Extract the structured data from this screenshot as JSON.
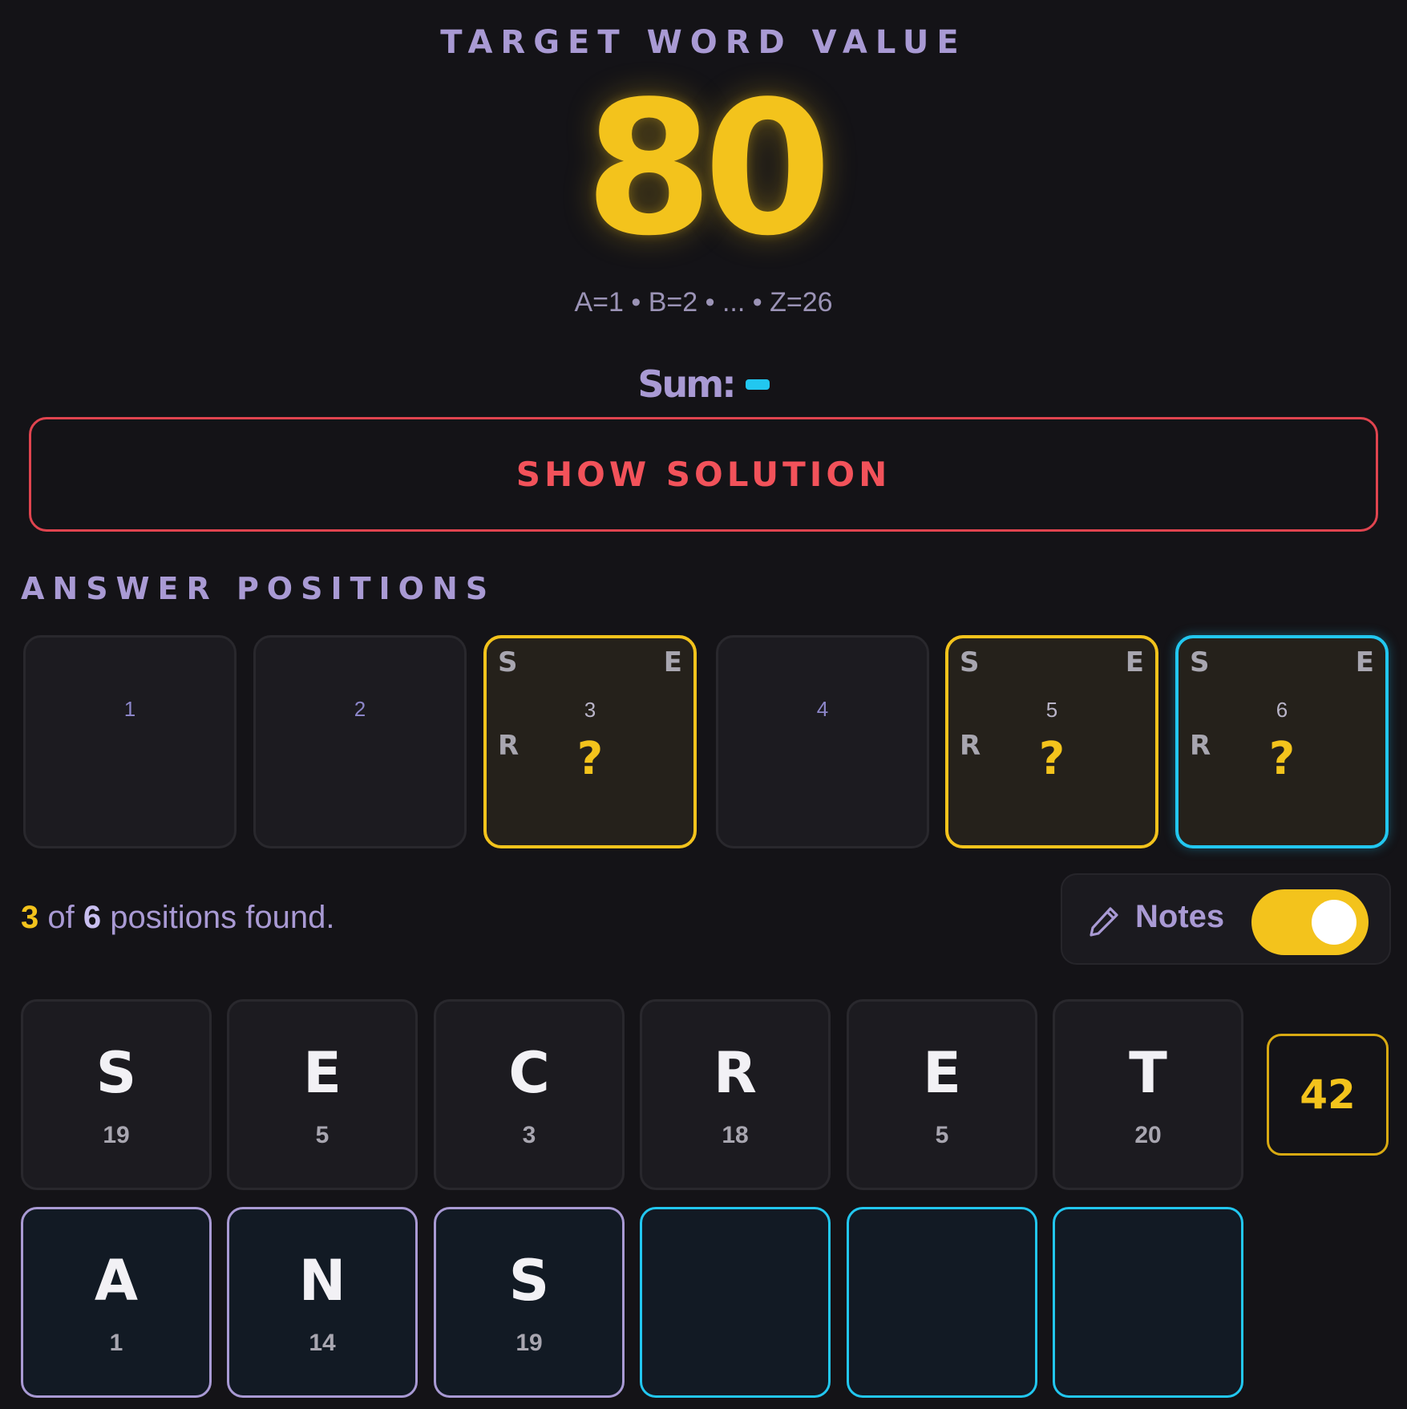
{
  "header": {
    "label": "TARGET WORD VALUE",
    "target": "80",
    "legend": "A=1 • B=2 • ... • Z=26",
    "sum_label": "Sum:"
  },
  "show_solution_label": "SHOW SOLUTION",
  "answer_positions": {
    "title": "ANSWER POSITIONS",
    "slots": [
      {
        "number": "1"
      },
      {
        "number": "2"
      },
      {
        "number": "3",
        "s": "S",
        "e": "E",
        "r": "R",
        "mark": "?"
      },
      {
        "number": "4"
      },
      {
        "number": "5",
        "s": "S",
        "e": "E",
        "r": "R",
        "mark": "?"
      },
      {
        "number": "6",
        "s": "S",
        "e": "E",
        "r": "R",
        "mark": "?"
      }
    ]
  },
  "status": {
    "found": "3",
    "of_word": "of",
    "total": "6",
    "suffix": "positions found."
  },
  "notes": {
    "label": "Notes",
    "icon": "pencil-icon",
    "enabled": true
  },
  "word_row": {
    "tiles": [
      {
        "letter": "S",
        "value": "19"
      },
      {
        "letter": "E",
        "value": "5"
      },
      {
        "letter": "C",
        "value": "3"
      },
      {
        "letter": "R",
        "value": "18"
      },
      {
        "letter": "E",
        "value": "5"
      },
      {
        "letter": "T",
        "value": "20"
      }
    ],
    "sum": "42"
  },
  "answer_row": {
    "tiles": [
      {
        "letter": "A",
        "value": "1"
      },
      {
        "letter": "N",
        "value": "14"
      },
      {
        "letter": "S",
        "value": "19"
      }
    ]
  },
  "colors": {
    "accent_yellow": "#f3c31c",
    "accent_cyan": "#22c7f0",
    "accent_lavender": "#a99ad4",
    "danger_red": "#f2525a",
    "background": "#141317"
  }
}
